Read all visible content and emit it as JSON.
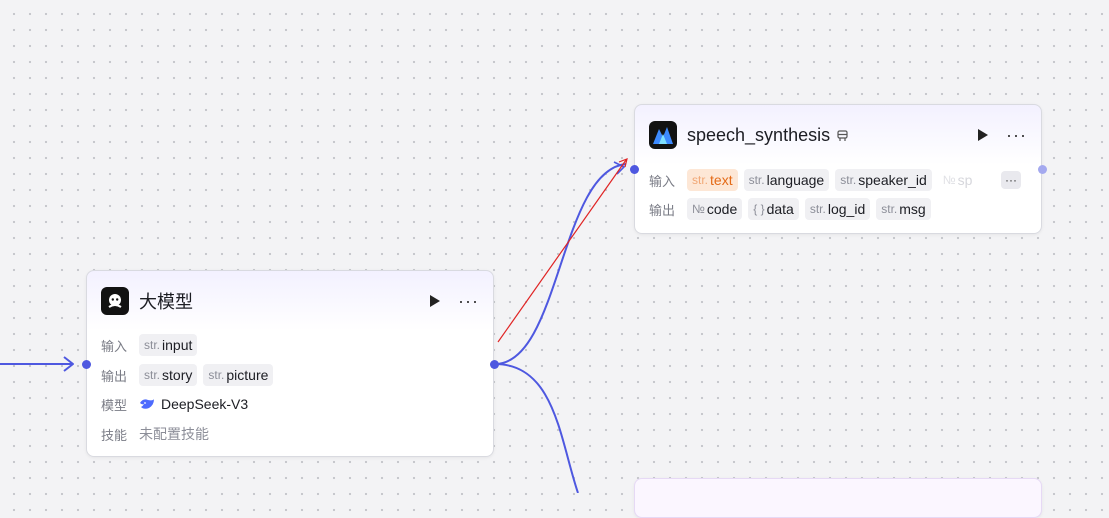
{
  "colors": {
    "edge": "#4e58e0",
    "drag_edge": "#e02424",
    "highlight": "#e46a17"
  },
  "llm_node": {
    "title": "大模型",
    "icon": "llm-avatar-icon",
    "input_label": "输入",
    "inputs": [
      {
        "type": "str.",
        "name": "input"
      }
    ],
    "output_label": "输出",
    "outputs": [
      {
        "type": "str.",
        "name": "story"
      },
      {
        "type": "str.",
        "name": "picture"
      }
    ],
    "model_label": "模型",
    "model_icon": "deepseek-whale-icon",
    "model": "DeepSeek-V3",
    "skills_label": "技能",
    "skills": "未配置技能"
  },
  "speech_node": {
    "title": "speech_synthesis",
    "icon": "volcano-speech-icon",
    "badge_icon": "plugin-badge-icon",
    "input_label": "输入",
    "inputs": [
      {
        "type": "str.",
        "name": "text"
      },
      {
        "type": "str.",
        "name": "language"
      },
      {
        "type": "str.",
        "name": "speaker_id"
      },
      {
        "type": "№",
        "name": "sp"
      }
    ],
    "more_inputs": "···",
    "output_label": "输出",
    "outputs": [
      {
        "type": "№",
        "name": "code"
      },
      {
        "type": "{ }",
        "name": "data"
      },
      {
        "type": "str.",
        "name": "log_id"
      },
      {
        "type": "str.",
        "name": "msg"
      }
    ]
  }
}
